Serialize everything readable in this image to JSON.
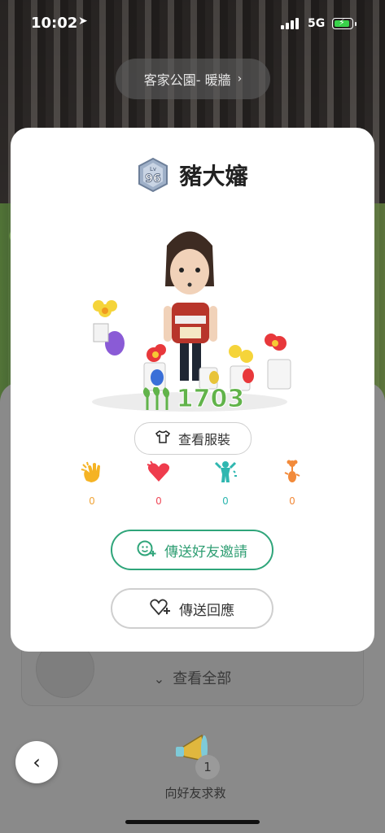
{
  "status_bar": {
    "time": "10:02",
    "network": "5G"
  },
  "location": {
    "label": "客家公園- 暖牆",
    "chevron": "›"
  },
  "profile": {
    "level": "96",
    "level_prefix": "Lv",
    "name": "豬大嬸",
    "pikmin_count": "1703"
  },
  "buttons": {
    "view_outfit": "查看服裝",
    "send_invite": "傳送好友邀請",
    "send_reply": "傳送回應"
  },
  "reactions": [
    {
      "icon": "clap-icon",
      "count": "0"
    },
    {
      "icon": "heart-icon",
      "count": "0"
    },
    {
      "icon": "cheer-icon",
      "count": "0"
    },
    {
      "icon": "flower-pikmin-icon",
      "count": "0"
    }
  ],
  "background": {
    "view_all": "查看全部"
  },
  "bottom": {
    "sos_label": "向好友求救",
    "sos_count": "1",
    "back_icon": "‹"
  },
  "colors": {
    "accent_green": "#2fa57a",
    "count_green": "#61b34a"
  }
}
